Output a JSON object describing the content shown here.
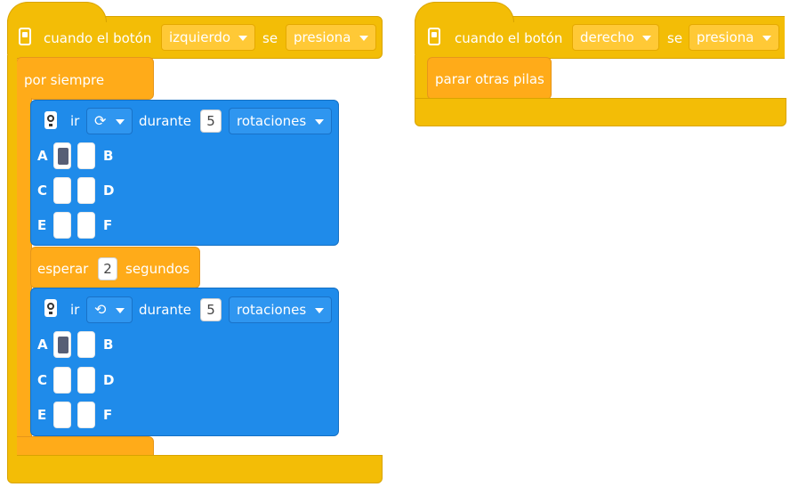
{
  "stacks": {
    "left": {
      "event": {
        "prefix": "cuando el botón",
        "button_option": "izquierdo",
        "joiner": "se",
        "action_option": "presiona"
      },
      "forever_label": "por siempre",
      "motor_blocks": [
        {
          "verb": "ir",
          "direction_icon": "rotate-clockwise-icon",
          "direction_glyph": "⟳",
          "during": "durante",
          "amount": "5",
          "unit": "rotaciones",
          "ports": {
            "A": true,
            "B": false,
            "C": false,
            "D": false,
            "E": false,
            "F": false
          }
        },
        {
          "verb": "ir",
          "direction_icon": "rotate-counterclockwise-icon",
          "direction_glyph": "⟲",
          "during": "durante",
          "amount": "5",
          "unit": "rotaciones",
          "ports": {
            "A": true,
            "B": false,
            "C": false,
            "D": false,
            "E": false,
            "F": false
          }
        }
      ],
      "wait": {
        "label": "esperar",
        "value": "2",
        "unit": "segundos"
      }
    },
    "right": {
      "event": {
        "prefix": "cuando el botón",
        "button_option": "derecho",
        "joiner": "se",
        "action_option": "presiona"
      },
      "stop_label": "parar otras pilas"
    }
  },
  "port_labels": {
    "A": "A",
    "B": "B",
    "C": "C",
    "D": "D",
    "E": "E",
    "F": "F"
  },
  "colors": {
    "event": "#f3bd06",
    "control": "#ffab19",
    "motion": "#1f8bea",
    "port_active": "#575e75"
  }
}
